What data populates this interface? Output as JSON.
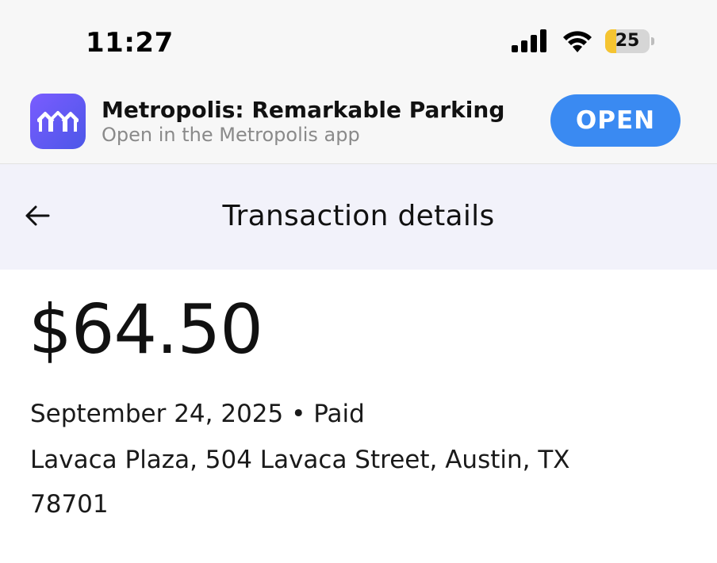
{
  "status_bar": {
    "time": "11:27",
    "battery_level": "25",
    "battery_fraction": 0.25,
    "battery_color": "#f5c431",
    "icons": [
      "signal-icon",
      "wifi-icon",
      "battery-icon"
    ]
  },
  "app_banner": {
    "app_name": "Metropolis: Remarkable Parking",
    "subtitle": "Open in the Metropolis app",
    "open_label": "OPEN",
    "accent_color": "#3a8af2",
    "icon": "metropolis-logo-icon"
  },
  "header": {
    "title": "Transaction details",
    "back_icon": "arrow-left-icon",
    "background": "#f2f2fa"
  },
  "transaction": {
    "amount": "$64.50",
    "date_status": "September 24, 2025 • Paid",
    "address_line_1": "Lavaca Plaza, 504 Lavaca Street, Austin, TX",
    "address_line_2": "78701"
  }
}
